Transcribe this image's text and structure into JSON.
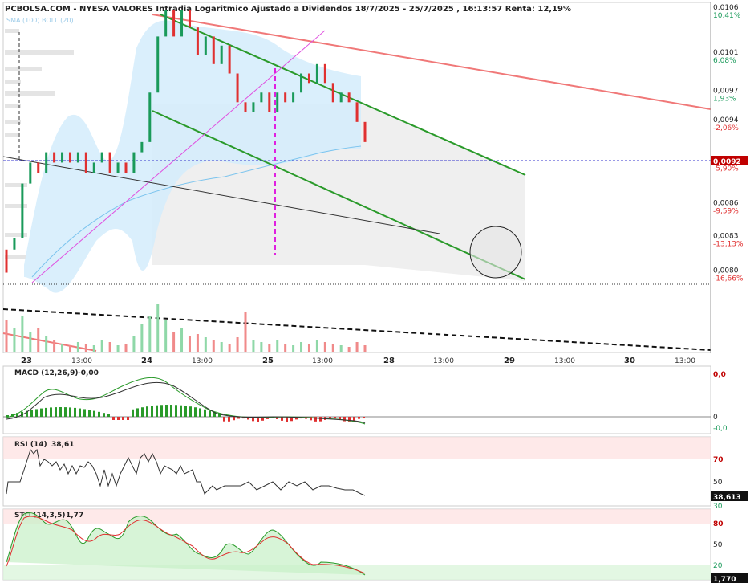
{
  "header": {
    "title": "PCBOLSA.COM - NYESA VALORES Intradia Logaritmico Ajustado a Dividendos 18/7/2025 - 25/7/2025 , 16:13:57 Renta: 12,19%",
    "legend": "SMA (100) BOLL (20)"
  },
  "colors": {
    "up": "#e03030",
    "down": "#1a9a5a",
    "channel": "#2a9a2a",
    "resistance": "#f07878",
    "support": "#222222",
    "trend": "#e050e0",
    "boll": "#d4ecfb",
    "current": "#3333cc",
    "vol_up": "#8fd8a8",
    "vol_down": "#f08a8a"
  },
  "price_axis": {
    "ticks": [
      {
        "price": "0,0106",
        "pct": "10,41%",
        "sign": "pos"
      },
      {
        "price": "0,0101",
        "pct": "6,08%",
        "sign": "pos"
      },
      {
        "price": "0,0097",
        "pct": "1,93%",
        "sign": "pos"
      },
      {
        "price": "0,0094",
        "pct": "-2,06%",
        "sign": "neg"
      },
      {
        "price": "0,0090",
        "pct": "-5,90%",
        "sign": "neg"
      },
      {
        "price": "0,0086",
        "pct": "-9,59%",
        "sign": "neg"
      },
      {
        "price": "0,0083",
        "pct": "-13,13%",
        "sign": "neg"
      },
      {
        "price": "0,0080",
        "pct": "-16,66%",
        "sign": "neg"
      }
    ],
    "current": "0,0092"
  },
  "x_axis": {
    "labels": [
      {
        "text": "23",
        "type": "day"
      },
      {
        "text": "13:00",
        "type": "hour"
      },
      {
        "text": "24",
        "type": "day"
      },
      {
        "text": "13:00",
        "type": "hour"
      },
      {
        "text": "25",
        "type": "day"
      },
      {
        "text": "13:00",
        "type": "hour"
      },
      {
        "text": "28",
        "type": "day"
      },
      {
        "text": "13:00",
        "type": "hour"
      },
      {
        "text": "29",
        "type": "day"
      },
      {
        "text": "13:00",
        "type": "hour"
      },
      {
        "text": "30",
        "type": "day"
      },
      {
        "text": "13:00",
        "type": "hour"
      }
    ]
  },
  "macd": {
    "label": "MACD (12,26,9)",
    "value": "-0,00",
    "axis": [
      "0,0",
      "0",
      "-0,0"
    ]
  },
  "rsi": {
    "label": "RSI (14)",
    "value": "38,61",
    "axis": [
      "70",
      "50",
      "30"
    ],
    "badge": "38,613"
  },
  "sto": {
    "label": "STO (14,3,5)",
    "value": "1,77",
    "axis": [
      "80",
      "50",
      "20"
    ],
    "badge": "1,770"
  },
  "chart_data": {
    "type": "candlestick",
    "title": "PCBOLSA.COM - NYESA VALORES Intradia Logaritmico Ajustado a Dividendos 18/7/2025 - 25/7/2025",
    "scale": "log",
    "ylim": [
      0.0077,
      0.0106
    ],
    "last_price": 0.0092,
    "renta": "12,19%",
    "candles": [
      {
        "o": 0.0082,
        "c": 0.008,
        "v": 40
      },
      {
        "o": 0.0082,
        "c": 0.0083,
        "v": 30
      },
      {
        "o": 0.0083,
        "c": 0.0088,
        "v": 45
      },
      {
        "o": 0.0088,
        "c": 0.009,
        "v": 25
      },
      {
        "o": 0.009,
        "c": 0.0089,
        "v": 30
      },
      {
        "o": 0.0089,
        "c": 0.0091,
        "v": 20
      },
      {
        "o": 0.0091,
        "c": 0.009,
        "v": 15
      },
      {
        "o": 0.009,
        "c": 0.0091,
        "v": 10
      },
      {
        "o": 0.0091,
        "c": 0.009,
        "v": 8
      },
      {
        "o": 0.009,
        "c": 0.0091,
        "v": 12
      },
      {
        "o": 0.0091,
        "c": 0.0089,
        "v": 10
      },
      {
        "o": 0.0089,
        "c": 0.009,
        "v": 8
      },
      {
        "o": 0.009,
        "c": 0.0091,
        "v": 15
      },
      {
        "o": 0.0091,
        "c": 0.0089,
        "v": 12
      },
      {
        "o": 0.0089,
        "c": 0.009,
        "v": 8
      },
      {
        "o": 0.009,
        "c": 0.0089,
        "v": 10
      },
      {
        "o": 0.0089,
        "c": 0.0091,
        "v": 20
      },
      {
        "o": 0.0091,
        "c": 0.0092,
        "v": 35
      },
      {
        "o": 0.0092,
        "c": 0.0097,
        "v": 45
      },
      {
        "o": 0.0097,
        "c": 0.0103,
        "v": 60
      },
      {
        "o": 0.0103,
        "c": 0.0106,
        "v": 40
      },
      {
        "o": 0.0106,
        "c": 0.0103,
        "v": 25
      },
      {
        "o": 0.0103,
        "c": 0.0106,
        "v": 30
      },
      {
        "o": 0.0106,
        "c": 0.0104,
        "v": 20
      },
      {
        "o": 0.0104,
        "c": 0.0101,
        "v": 22
      },
      {
        "o": 0.0101,
        "c": 0.0103,
        "v": 18
      },
      {
        "o": 0.0103,
        "c": 0.01,
        "v": 15
      },
      {
        "o": 0.01,
        "c": 0.0102,
        "v": 12
      },
      {
        "o": 0.0102,
        "c": 0.0099,
        "v": 10
      },
      {
        "o": 0.0099,
        "c": 0.0096,
        "v": 18
      },
      {
        "o": 0.0096,
        "c": 0.0095,
        "v": 50
      },
      {
        "o": 0.0095,
        "c": 0.0096,
        "v": 15
      },
      {
        "o": 0.0096,
        "c": 0.0097,
        "v": 12
      },
      {
        "o": 0.0097,
        "c": 0.0095,
        "v": 10
      },
      {
        "o": 0.0095,
        "c": 0.0097,
        "v": 14
      },
      {
        "o": 0.0097,
        "c": 0.0096,
        "v": 10
      },
      {
        "o": 0.0096,
        "c": 0.0097,
        "v": 8
      },
      {
        "o": 0.0097,
        "c": 0.0099,
        "v": 12
      },
      {
        "o": 0.0099,
        "c": 0.0098,
        "v": 10
      },
      {
        "o": 0.0098,
        "c": 0.01,
        "v": 15
      },
      {
        "o": 0.01,
        "c": 0.0098,
        "v": 12
      },
      {
        "o": 0.0098,
        "c": 0.0096,
        "v": 10
      },
      {
        "o": 0.0096,
        "c": 0.0097,
        "v": 8
      },
      {
        "o": 0.0097,
        "c": 0.0096,
        "v": 6
      },
      {
        "o": 0.0096,
        "c": 0.0094,
        "v": 12
      },
      {
        "o": 0.0094,
        "c": 0.0092,
        "v": 8
      }
    ],
    "overlays": [
      "SMA (100)",
      "BOLL (20)"
    ]
  }
}
